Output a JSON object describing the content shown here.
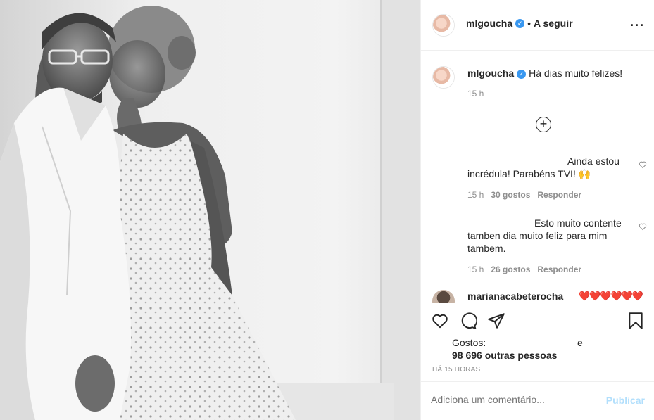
{
  "post": {
    "username": "mlgoucha",
    "follow_status": "A seguir",
    "more_icon": "more-options-icon",
    "caption": "Há dias muito felizes!",
    "caption_time": "15 h"
  },
  "comments": [
    {
      "line1": "Ainda estou",
      "line2": "incrédula! Parabéns TVI! 🙌",
      "time": "15 h",
      "likes": "30 gostos",
      "reply": "Responder"
    },
    {
      "line1": "Esto muito contente",
      "line2": "tamben dia muito feliz para mim",
      "line3": "tambem.",
      "time": "15 h",
      "likes": "26 gostos",
      "reply": "Responder"
    },
    {
      "username": "marianacabeterocha",
      "text": "❤️❤️❤️❤️❤️❤️"
    }
  ],
  "actions": {
    "likes_label": "Gostos:",
    "likes_and": "e",
    "likes_count": "98 696 outras pessoas",
    "posted_ago": "HÁ 15 HORAS"
  },
  "add_comment": {
    "placeholder": "Adiciona um comentário...",
    "publish_label": "Publicar"
  },
  "colors": {
    "verified": "#3897f0",
    "secondary_text": "#8e8e8e",
    "publish_disabled": "#b2dffc",
    "hearts": "#ed4956"
  }
}
